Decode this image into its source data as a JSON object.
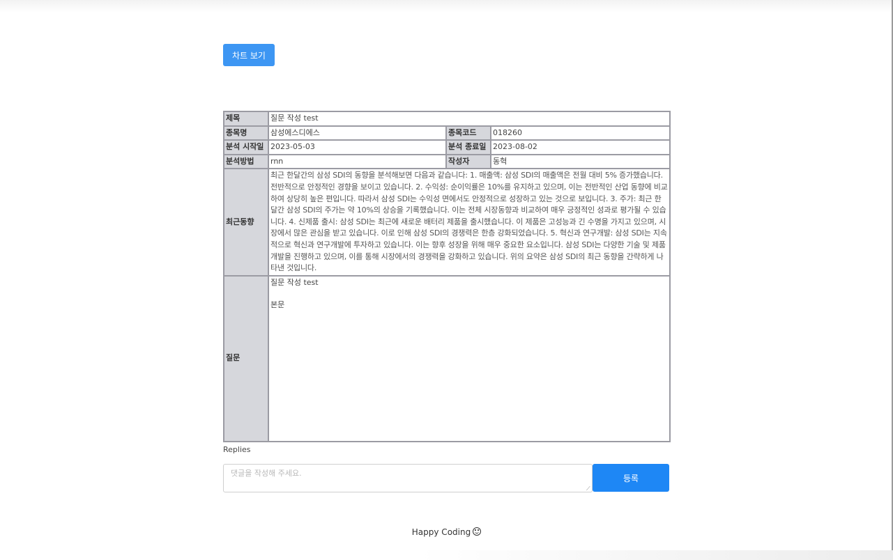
{
  "toolbar": {
    "chart_button": "차트 보기"
  },
  "info_table": {
    "title_label": "제목",
    "title_value": "질문 작성 test",
    "stock_name_label": "종목명",
    "stock_name_value": "삼성에스디에스",
    "stock_code_label": "종목코드",
    "stock_code_value": "018260",
    "start_date_label": "분석 시작일",
    "start_date_value": "2023-05-03",
    "end_date_label": "분석 종료일",
    "end_date_value": "2023-08-02",
    "method_label": "분석방법",
    "method_value": "rnn",
    "author_label": "작성자",
    "author_value": "동혁",
    "trend_label": "최근동향",
    "trend_value": "최근 한달간의 삼성 SDI의 동향을 분석해보면 다음과 같습니다: 1. 매출액: 삼성 SDI의 매출액은 전월 대비 5% 증가했습니다. 전반적으로 안정적인 경향을 보이고 있습니다. 2. 수익성: 순이익률은 10%를 유지하고 있으며, 이는 전반적인 산업 동향에 비교하여 상당히 높은 편입니다. 따라서 삼성 SDI는 수익성 면에서도 안정적으로 성장하고 있는 것으로 보입니다. 3. 주가: 최근 한달간 삼성 SDI의 주가는 약 10%의 상승을 기록했습니다. 이는 전체 시장동향과 비교하여 매우 긍정적인 성과로 평가될 수 있습니다. 4. 신제품 출시: 삼성 SDI는 최근에 새로운 배터리 제품을 출시했습니다. 이 제품은 고성능과 긴 수명을 가지고 있으며, 시장에서 많은 관심을 받고 있습니다. 이로 인해 삼성 SDI의 경쟁력은 한층 강화되었습니다. 5. 혁신과 연구개발: 삼성 SDI는 지속적으로 혁신과 연구개발에 투자하고 있습니다. 이는 향후 성장을 위해 매우 중요한 요소입니다. 삼성 SDI는 다양한 기술 및 제품 개발을 진행하고 있으며, 이를 통해 시장에서의 경쟁력을 강화하고 있습니다. 위의 요약은 삼성 SDI의 최근 동향을 간략하게 나타낸 것입니다.",
    "question_label": "질문",
    "question_title": "질문 작성 test",
    "question_body": "본문"
  },
  "replies": {
    "label": "Replies",
    "placeholder": "댓글을 작성해 주세요.",
    "submit_label": "등록"
  },
  "footer": {
    "text": "Happy Coding"
  }
}
